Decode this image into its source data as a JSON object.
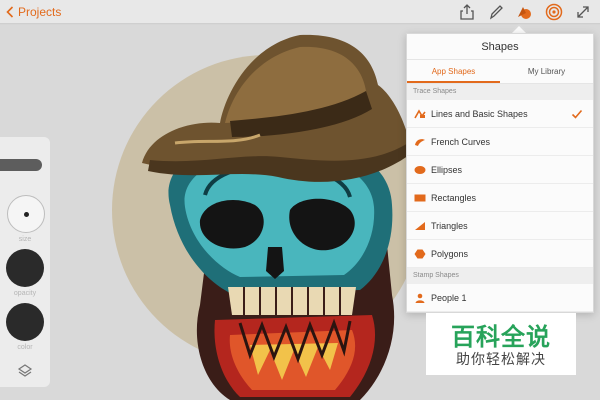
{
  "header": {
    "back_label": "Projects"
  },
  "toolbar": {
    "items": [
      "share-icon",
      "brush-icon",
      "shapes-icon",
      "target-icon",
      "expand-icon"
    ]
  },
  "rail": {
    "size_label": "size",
    "opacity_label": "opacity",
    "color_label": "color"
  },
  "popover": {
    "title": "Shapes",
    "tabs": [
      {
        "label": "App Shapes",
        "active": true
      },
      {
        "label": "My Library",
        "active": false
      }
    ],
    "trace_section": "Trace Shapes",
    "trace_items": [
      {
        "label": "Lines and Basic Shapes",
        "icon": "lines-shape-icon",
        "checked": true
      },
      {
        "label": "French Curves",
        "icon": "french-curve-icon",
        "checked": false
      },
      {
        "label": "Ellipses",
        "icon": "ellipse-icon",
        "checked": false
      },
      {
        "label": "Rectangles",
        "icon": "rectangle-icon",
        "checked": false
      },
      {
        "label": "Triangles",
        "icon": "triangle-icon",
        "checked": false
      },
      {
        "label": "Polygons",
        "icon": "polygon-icon",
        "checked": false
      }
    ],
    "stamp_section": "Stamp Shapes",
    "stamp_items": [
      {
        "label": "People 1",
        "icon": "person-icon"
      }
    ]
  },
  "watermark": {
    "title": "百科全说",
    "subtitle": "助你轻松解决"
  },
  "colors": {
    "accent": "#e26a1c",
    "watermark_green": "#27a35a"
  }
}
